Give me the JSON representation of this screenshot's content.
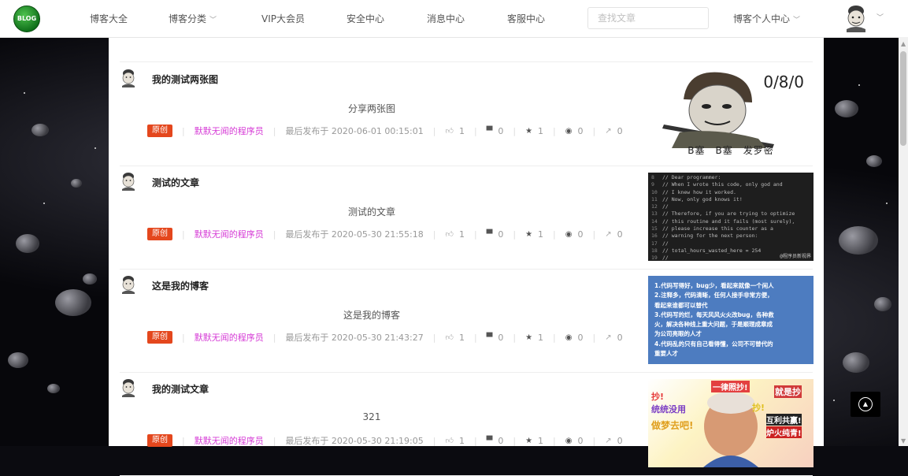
{
  "nav": {
    "logo_text": "BLOG",
    "items": [
      {
        "label": "博客大全",
        "has_caret": false
      },
      {
        "label": "博客分类",
        "has_caret": true
      },
      {
        "label": "VIP大会员",
        "has_caret": false
      },
      {
        "label": "安全中心",
        "has_caret": false
      },
      {
        "label": "消息中心",
        "has_caret": false
      },
      {
        "label": "客服中心",
        "has_caret": false
      }
    ],
    "search_placeholder": "查找文章",
    "user_center": "博客个人中心"
  },
  "posts": [
    {
      "title": "我的测试两张图",
      "summary": "分享两张图",
      "tag": "原创",
      "author": "默默无闻的程序员",
      "date_label": "最后发布于 2020-06-01 00:15:01",
      "likes": "1",
      "comments": "0",
      "favorites": "1",
      "views": "0",
      "shares": "0",
      "thumb": {
        "type": "meme",
        "text_top": "0/8/0",
        "caption": "B塞　B塞　发罗密"
      }
    },
    {
      "title": "测试的文章",
      "summary": "测试的文章",
      "tag": "原创",
      "author": "默默无闻的程序员",
      "date_label": "最后发布于 2020-05-30 21:55:18",
      "likes": "1",
      "comments": "0",
      "favorites": "1",
      "views": "0",
      "shares": "0",
      "thumb": {
        "type": "code",
        "lines": [
          {
            "n": "8",
            "t": "// Dear programmer:"
          },
          {
            "n": "9",
            "t": "// When I wrote this code, only god and"
          },
          {
            "n": "10",
            "t": "// I knew how it worked."
          },
          {
            "n": "11",
            "t": "// Now, only god knows it!"
          },
          {
            "n": "12",
            "t": "//"
          },
          {
            "n": "13",
            "t": "// Therefore, if you are trying to optimize"
          },
          {
            "n": "14",
            "t": "// this routine and it fails (most surely),"
          },
          {
            "n": "15",
            "t": "// please increase this counter as a"
          },
          {
            "n": "16",
            "t": "// warning for the next person:"
          },
          {
            "n": "17",
            "t": "//"
          },
          {
            "n": "18",
            "t": "// total_hours_wasted_here = 254"
          },
          {
            "n": "19",
            "t": "//"
          }
        ],
        "watermark": "@程序员新视界"
      }
    },
    {
      "title": "这是我的博客",
      "summary": "这是我的博客",
      "tag": "原创",
      "author": "默默无闻的程序员",
      "date_label": "最后发布于 2020-05-30 21:43:27",
      "likes": "1",
      "comments": "0",
      "favorites": "1",
      "views": "0",
      "shares": "0",
      "thumb": {
        "type": "text",
        "lines": [
          "1.代码写得好，bug少，看起来就像一个闲人",
          "2.注释多，代码清晰，任何人接手非常方便，",
          "看起来谁都可以替代",
          "3.代码写的烂，每天风风火火改bug，各种救",
          "火，解决各种线上重大问题，于是顺理成章成",
          "为公司亮眼的人才",
          "4.代码乱的只有自己看得懂，公司不可替代的",
          "重要人才"
        ]
      }
    },
    {
      "title": "我的测试文章",
      "summary": "321",
      "tag": "原创",
      "author": "默默无闻的程序员",
      "date_label": "最后发布于 2020-05-30 21:19:05",
      "likes": "1",
      "comments": "0",
      "favorites": "1",
      "views": "0",
      "shares": "0",
      "thumb": {
        "type": "meme2",
        "texts": [
          "一律照抄!",
          "抄!",
          "统统没用",
          "做梦去吧!",
          "就是抄",
          "互利共赢!",
          "炉火纯青!",
          "抄!"
        ]
      }
    }
  ],
  "colors": {
    "tag_bg": "#e4471d",
    "author": "#d63cd6",
    "logo": "#1b8a26"
  }
}
